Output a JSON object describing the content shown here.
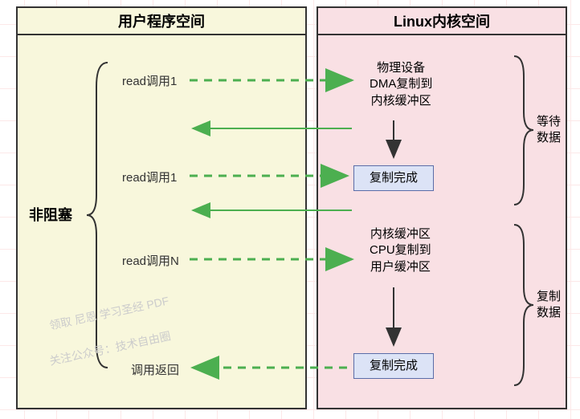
{
  "userSpace": {
    "title": "用户程序空间"
  },
  "kernelSpace": {
    "title": "Linux内核空间"
  },
  "nonblocking": "非阻塞",
  "rows": {
    "read1": "read调用1",
    "read1b": "read调用1",
    "readN": "read调用N",
    "return": "调用返回"
  },
  "kernel": {
    "step1": "物理设备\nDMA复制到\n内核缓冲区",
    "step2": "内核缓冲区\nCPU复制到\n用户缓冲区",
    "done": "复制完成"
  },
  "sideLabels": {
    "wait": "等待\n数据",
    "copy": "复制\n数据"
  },
  "watermark": {
    "line1": "领取 尼恩 学习圣经 PDF",
    "line2": "关注公众号：技术自由圈"
  },
  "colors": {
    "userBg": "#f8f7dc",
    "kernelBg": "#f9e0e4",
    "arrowGreen": "#4caf50",
    "doneBox": "#dce3f6"
  }
}
